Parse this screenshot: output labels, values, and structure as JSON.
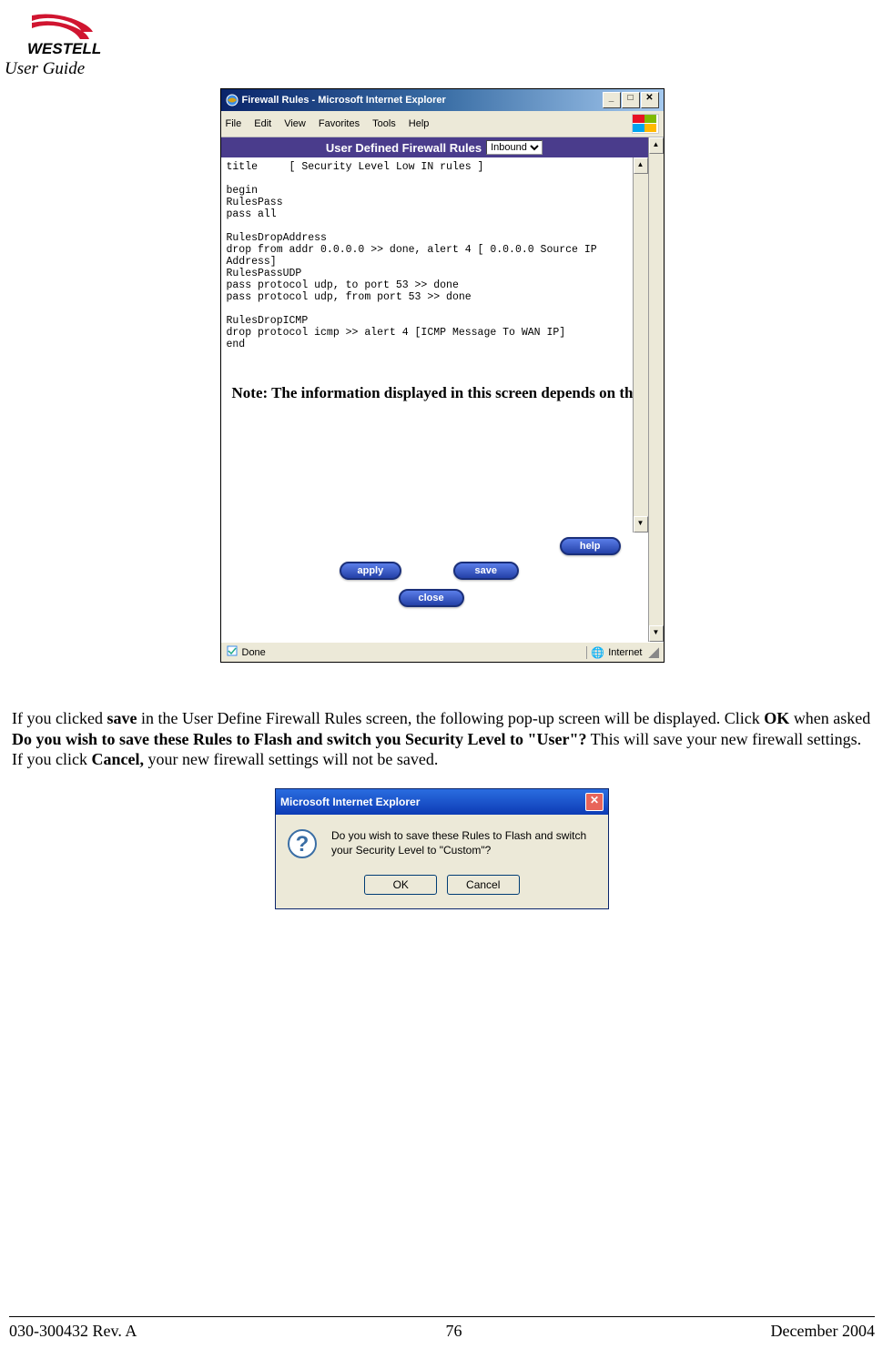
{
  "header": {
    "logo_text": "WESTELL",
    "user_guide": "User Guide"
  },
  "ie_window": {
    "title": "Firewall Rules - Microsoft Internet Explorer",
    "menu": [
      "File",
      "Edit",
      "View",
      "Favorites",
      "Tools",
      "Help"
    ],
    "panel_title": "User Defined Firewall Rules",
    "dropdown_selected": "Inbound",
    "rules_text": "title     [ Security Level Low IN rules ]\n\nbegin\nRulesPass\npass all\n\nRulesDropAddress\ndrop from addr 0.0.0.0 >> done, alert 4 [ 0.0.0.0 Source IP\nAddress]\nRulesPassUDP\npass protocol udp, to port 53 >> done\npass protocol udp, from port 53 >> done\n\nRulesDropICMP\ndrop protocol icmp >> alert 4 [ICMP Message To WAN IP]\nend",
    "note_overlay": "Note: The information displayed in this screen depends on the level of security you have selected.",
    "buttons": {
      "help": "help",
      "apply": "apply",
      "save": "save",
      "close": "close"
    },
    "status_left": "Done",
    "status_right": "Internet"
  },
  "body_text": {
    "p1_pre": "If you clicked ",
    "p1_b1": "save",
    "p1_mid1": " in the User Define Firewall Rules screen, the following pop-up screen will be displayed. Click ",
    "p1_b2": "OK",
    "p1_mid2": " when asked ",
    "p1_b3": "Do you wish to save these Rules to Flash and switch you Security Level to \"User\"?",
    "p1_mid3": " This will save your new firewall settings. If you click ",
    "p1_b4": "Cancel,",
    "p1_post": " your new firewall settings will not be saved."
  },
  "dialog": {
    "title": "Microsoft Internet Explorer",
    "message": "Do you wish to save these Rules to Flash and switch your Security Level to \"Custom\"?",
    "ok": "OK",
    "cancel": "Cancel"
  },
  "footer": {
    "left": "030-300432 Rev. A",
    "center": "76",
    "right": "December 2004"
  }
}
